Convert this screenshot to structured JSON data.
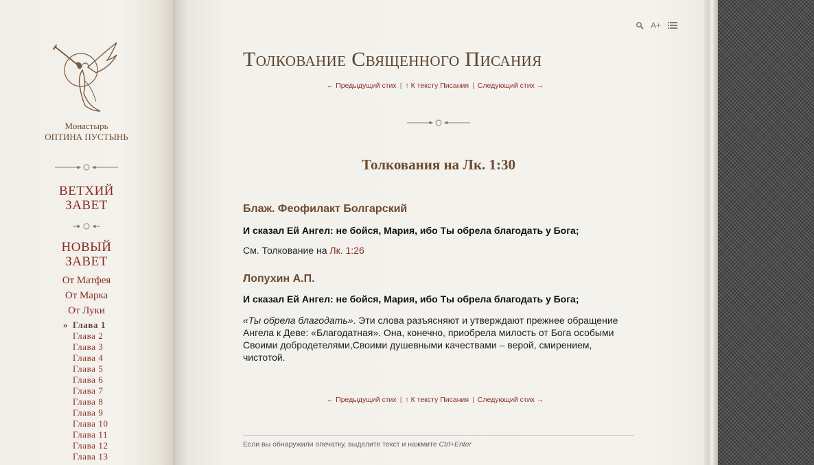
{
  "sidebar": {
    "monastery_line1": "Монастырь",
    "monastery_line2": "ОПТИНА ПУСТЫНЬ",
    "old_testament_line1": "ВЕТХИЙ",
    "old_testament_line2": "ЗАВЕТ",
    "new_testament_line1": "НОВЫЙ",
    "new_testament_line2": "ЗАВЕТ",
    "gospels": [
      "От Матфея",
      "От Марка",
      "От Луки"
    ],
    "active_mark": "»",
    "chapters": [
      "Глава 1",
      "Глава 2",
      "Глава 3",
      "Глава 4",
      "Глава 5",
      "Глава 6",
      "Глава 7",
      "Глава 8",
      "Глава 9",
      "Глава 10",
      "Глава 11",
      "Глава 12",
      "Глава 13"
    ]
  },
  "toolbar": {
    "search_icon": "search-icon",
    "font_size_label": "A+",
    "menu_icon": "list-icon"
  },
  "site_title": "Толкование Священного Писания",
  "nav": {
    "prev": "← Предыдущий стих",
    "to_text": "↑ К тексту Писания",
    "next": "Следующий стих →",
    "separator": "|"
  },
  "heading": "Толкования на Лк. 1:30",
  "commentaries": [
    {
      "author": "Блаж. Феофилакт Болгарский",
      "verse": "И сказал Ей Ангел: не бойся, Мария, ибо Ты обрела благодать у Бога;",
      "text_prefix": "См. Толкование на ",
      "link": "Лк. 1:26"
    },
    {
      "author": "Лопухин А.П.",
      "verse": "И сказал Ей Ангел: не бойся, Мария, ибо Ты обрела благодать у Бога;",
      "quote": "«Ты обрела благодать»",
      "text": ". Эти слова разъясняют и утверждают прежнее обращение Ангела к Деве: «Благодатная». Она, конечно, приобрела милость от Бога особыми Своими добродетелями,Своими душевными качествами – верой, смирением, чистотой."
    }
  ],
  "footnote": {
    "text": "Если вы обнаружили опечатку, выделите текст и нажмите ",
    "shortcut": "Ctrl+Enter"
  }
}
